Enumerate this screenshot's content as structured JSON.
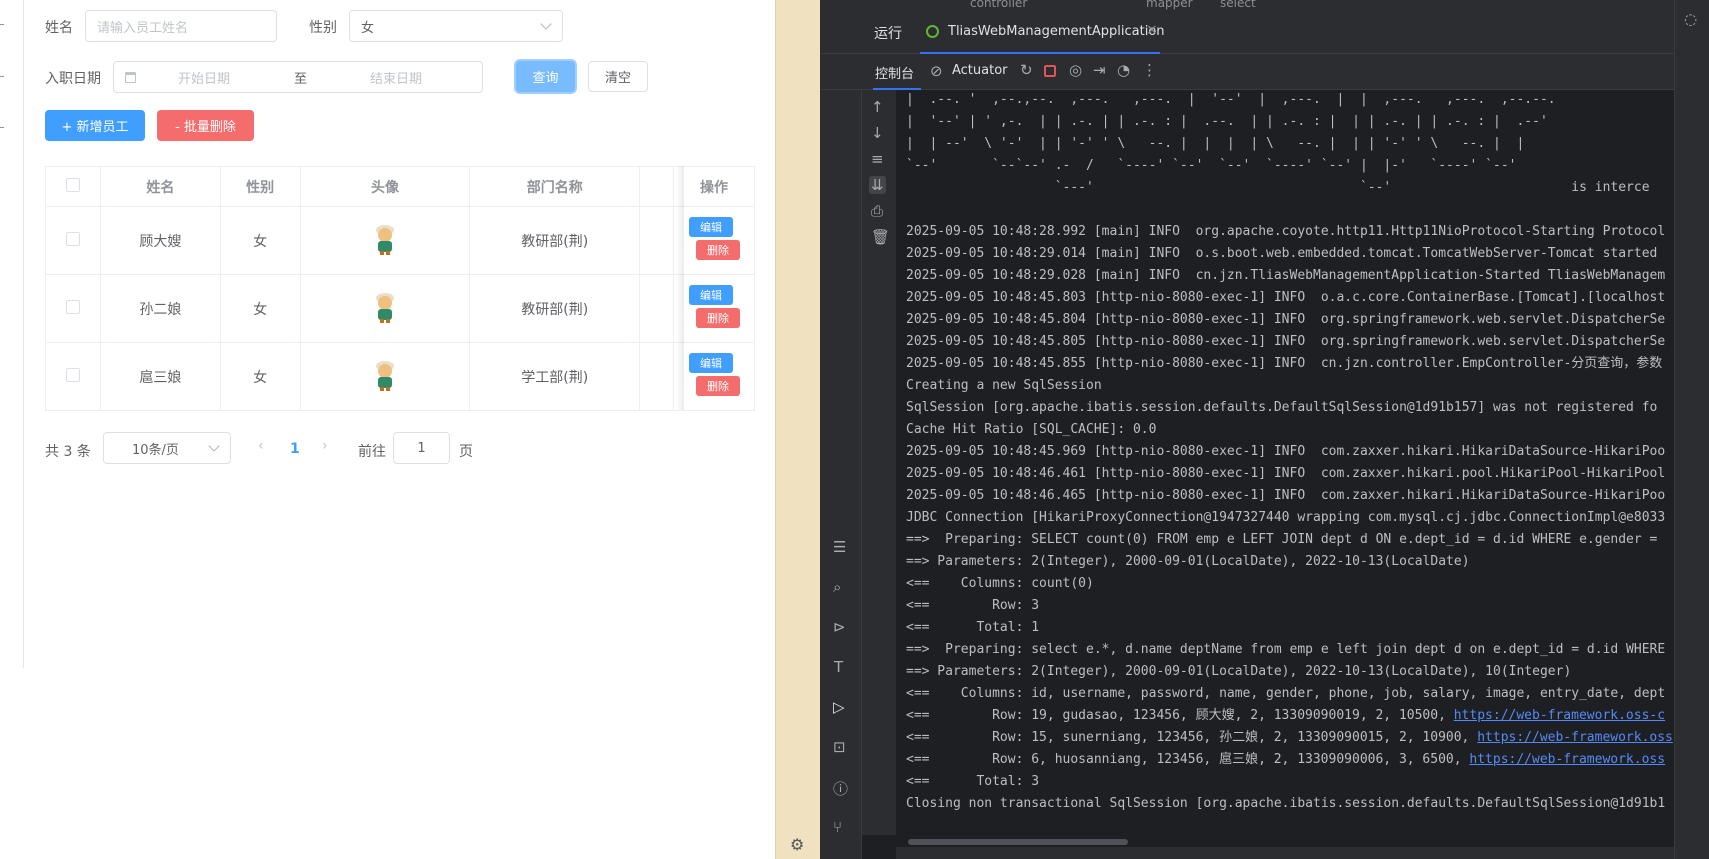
{
  "web": {
    "filters": {
      "name_label": "姓名",
      "name_placeholder": "请输入员工姓名",
      "gender_label": "性别",
      "gender_value": "女",
      "date_label": "入职日期",
      "start_placeholder": "开始日期",
      "range_sep": "至",
      "end_placeholder": "结束日期",
      "query_btn": "查询",
      "clear_btn": "清空"
    },
    "actions": {
      "add_btn": "+ 新增员工",
      "batch_delete_btn": "- 批量删除"
    },
    "table": {
      "headers": [
        "姓名",
        "性别",
        "头像",
        "部门名称",
        "操作"
      ],
      "rows": [
        {
          "name": "顾大嫂",
          "gender": "女",
          "dept": "教研部(荆)",
          "edit": "编辑",
          "delete": "删除"
        },
        {
          "name": "孙二娘",
          "gender": "女",
          "dept": "教研部(荆)",
          "edit": "编辑",
          "delete": "删除"
        },
        {
          "name": "扈三娘",
          "gender": "女",
          "dept": "学工部(荆)",
          "edit": "编辑",
          "delete": "删除"
        }
      ]
    },
    "pager": {
      "total": "共 3 条",
      "page_size": "10条/页",
      "current_page": "1",
      "goto_label": "前往",
      "goto_value": "1",
      "page_unit": "页"
    }
  },
  "ide": {
    "top_crumbs": [
      "controller",
      "mapper",
      "select"
    ],
    "tab_run_label": "运行",
    "tab_app": "TliasWebManagementApplication",
    "toolbar_console": "控制台",
    "toolbar_actuator": "Actuator",
    "console_lines": [
      {
        "t": "|  .--. '  ,--.,--.  ,---.   ,---.  |  '--'  |  ,---.  |  |  ,---.   ,---.  ,--.--."
      },
      {
        "t": "|  '--' | ' ,-.  | | .-. | | .-. : |  .--.  | | .-. : |  | | .-. | | .-. : |  .--'"
      },
      {
        "t": "|  | --'  \\ '-'  | | '-' ' \\   --. |  |  |  | \\   --. |  | | '-' ' \\   --. |  |"
      },
      {
        "t": "`--'       `--`--' .-  /   `----' `--'  `--'  `----' `--' |  |-'   `----' `--'"
      },
      {
        "t": "                   `---'                                  `--'                       is interce"
      },
      {
        "t": ""
      },
      {
        "t": "2025-09-05 10:48:28.992 [main] INFO  org.apache.coyote.http11.Http11NioProtocol-Starting Protocol"
      },
      {
        "t": "2025-09-05 10:48:29.014 [main] INFO  o.s.boot.web.embedded.tomcat.TomcatWebServer-Tomcat started"
      },
      {
        "t": "2025-09-05 10:48:29.028 [main] INFO  cn.jzn.TliasWebManagementApplication-Started TliasWebManagem"
      },
      {
        "t": "2025-09-05 10:48:45.803 [http-nio-8080-exec-1] INFO  o.a.c.core.ContainerBase.[Tomcat].[localhost"
      },
      {
        "t": "2025-09-05 10:48:45.804 [http-nio-8080-exec-1] INFO  org.springframework.web.servlet.DispatcherSe"
      },
      {
        "t": "2025-09-05 10:48:45.805 [http-nio-8080-exec-1] INFO  org.springframework.web.servlet.DispatcherSe"
      },
      {
        "t": "2025-09-05 10:48:45.855 [http-nio-8080-exec-1] INFO  cn.jzn.controller.EmpController-分页查询，参数"
      },
      {
        "t": "Creating a new SqlSession"
      },
      {
        "t": "SqlSession [org.apache.ibatis.session.defaults.DefaultSqlSession@1d91b157] was not registered fo"
      },
      {
        "t": "Cache Hit Ratio [SQL_CACHE]: 0.0"
      },
      {
        "t": "2025-09-05 10:48:45.969 [http-nio-8080-exec-1] INFO  com.zaxxer.hikari.HikariDataSource-HikariPoo"
      },
      {
        "t": "2025-09-05 10:48:46.461 [http-nio-8080-exec-1] INFO  com.zaxxer.hikari.pool.HikariPool-HikariPool"
      },
      {
        "t": "2025-09-05 10:48:46.465 [http-nio-8080-exec-1] INFO  com.zaxxer.hikari.HikariDataSource-HikariPoo"
      },
      {
        "t": "JDBC Connection [HikariProxyConnection@1947327440 wrapping com.mysql.cj.jdbc.ConnectionImpl@e8033"
      },
      {
        "t": "==>  Preparing: SELECT count(0) FROM emp e LEFT JOIN dept d ON e.dept_id = d.id WHERE e.gender ="
      },
      {
        "t": "==> Parameters: 2(Integer), 2000-09-01(LocalDate), 2022-10-13(LocalDate)"
      },
      {
        "t": "<==    Columns: count(0)"
      },
      {
        "t": "<==        Row: 3"
      },
      {
        "t": "<==      Total: 1"
      },
      {
        "t": "==>  Preparing: select e.*, d.name deptName from emp e left join dept d on e.dept_id = d.id WHERE"
      },
      {
        "t": "==> Parameters: 2(Integer), 2000-09-01(LocalDate), 2022-10-13(LocalDate), 10(Integer)"
      },
      {
        "t": "<==    Columns: id, username, password, name, gender, phone, job, salary, image, entry_date, dept"
      },
      {
        "t": "<==        Row: 19, gudasao, 123456, 顾大嫂, 2, 13309090019, 2, 10500, ",
        "link": "https://web-framework.oss-c"
      },
      {
        "t": "<==        Row: 15, sunerniang, 123456, 孙二娘, 2, 13309090015, 2, 10900, ",
        "link": "https://web-framework.oss"
      },
      {
        "t": "<==        Row: 6, huosanniang, 123456, 扈三娘, 2, 13309090006, 3, 6500, ",
        "link": "https://web-framework.oss"
      },
      {
        "t": "<==      Total: 3"
      },
      {
        "t": "Closing non transactional SqlSession [org.apache.ibatis.session.defaults.DefaultSqlSession@1d91b1"
      }
    ]
  },
  "colors": {
    "primary": "#409eff",
    "danger": "#f56c6c",
    "ide_bg": "#1e1f22",
    "link": "#548af7"
  }
}
